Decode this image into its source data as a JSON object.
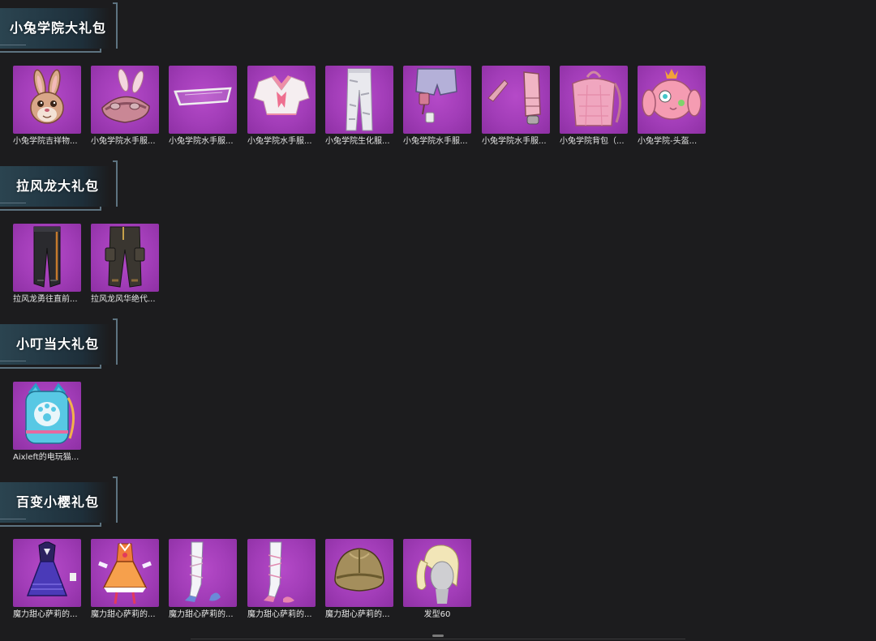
{
  "sections": [
    {
      "title": "小兔学院大礼包",
      "items": [
        {
          "name": "小兔学院吉祥物...",
          "icon": "bunny-mascot-mask-icon"
        },
        {
          "name": "小兔学院水手服...",
          "icon": "bunny-ear-helmet-icon"
        },
        {
          "name": "小兔学院水手服...",
          "icon": "goggles-icon"
        },
        {
          "name": "小兔学院水手服...",
          "icon": "sailor-top-icon"
        },
        {
          "name": "小兔学院生化服...",
          "icon": "white-pants-icon"
        },
        {
          "name": "小兔学院水手服...",
          "icon": "sailor-shorts-icon"
        },
        {
          "name": "小兔学院水手服...",
          "icon": "gloves-icon"
        },
        {
          "name": "小兔学院背包（...",
          "icon": "pink-backpack-icon"
        },
        {
          "name": "小兔学院-头盔...",
          "icon": "bunny-helmet-icon"
        }
      ]
    },
    {
      "title": "拉风龙大礼包",
      "items": [
        {
          "name": "拉风龙勇往直前...",
          "icon": "dark-pants-icon"
        },
        {
          "name": "拉风龙风华绝代...",
          "icon": "cargo-pants-icon"
        }
      ]
    },
    {
      "title": "小叮当大礼包",
      "items": [
        {
          "name": "Aixleft的电玩猫...",
          "icon": "cat-backpack-icon"
        }
      ]
    },
    {
      "title": "百变小樱礼包",
      "items": [
        {
          "name": "魔力甜心萨莉的...",
          "icon": "purple-dress-icon"
        },
        {
          "name": "魔力甜心萨莉的...",
          "icon": "orange-dress-icon"
        },
        {
          "name": "魔力甜心萨莉的...",
          "icon": "blue-stocking-icon"
        },
        {
          "name": "魔力甜心萨莉的...",
          "icon": "pink-stocking-icon"
        },
        {
          "name": "魔力甜心萨莉的...",
          "icon": "gold-helmet-icon"
        },
        {
          "name": "发型60",
          "icon": "hairstyle-head-icon"
        }
      ]
    }
  ],
  "colors": {
    "background": "#1c1c1e",
    "tile": "#a23db8",
    "header_plate": "#2b4450",
    "frame_line": "#5d7380"
  }
}
